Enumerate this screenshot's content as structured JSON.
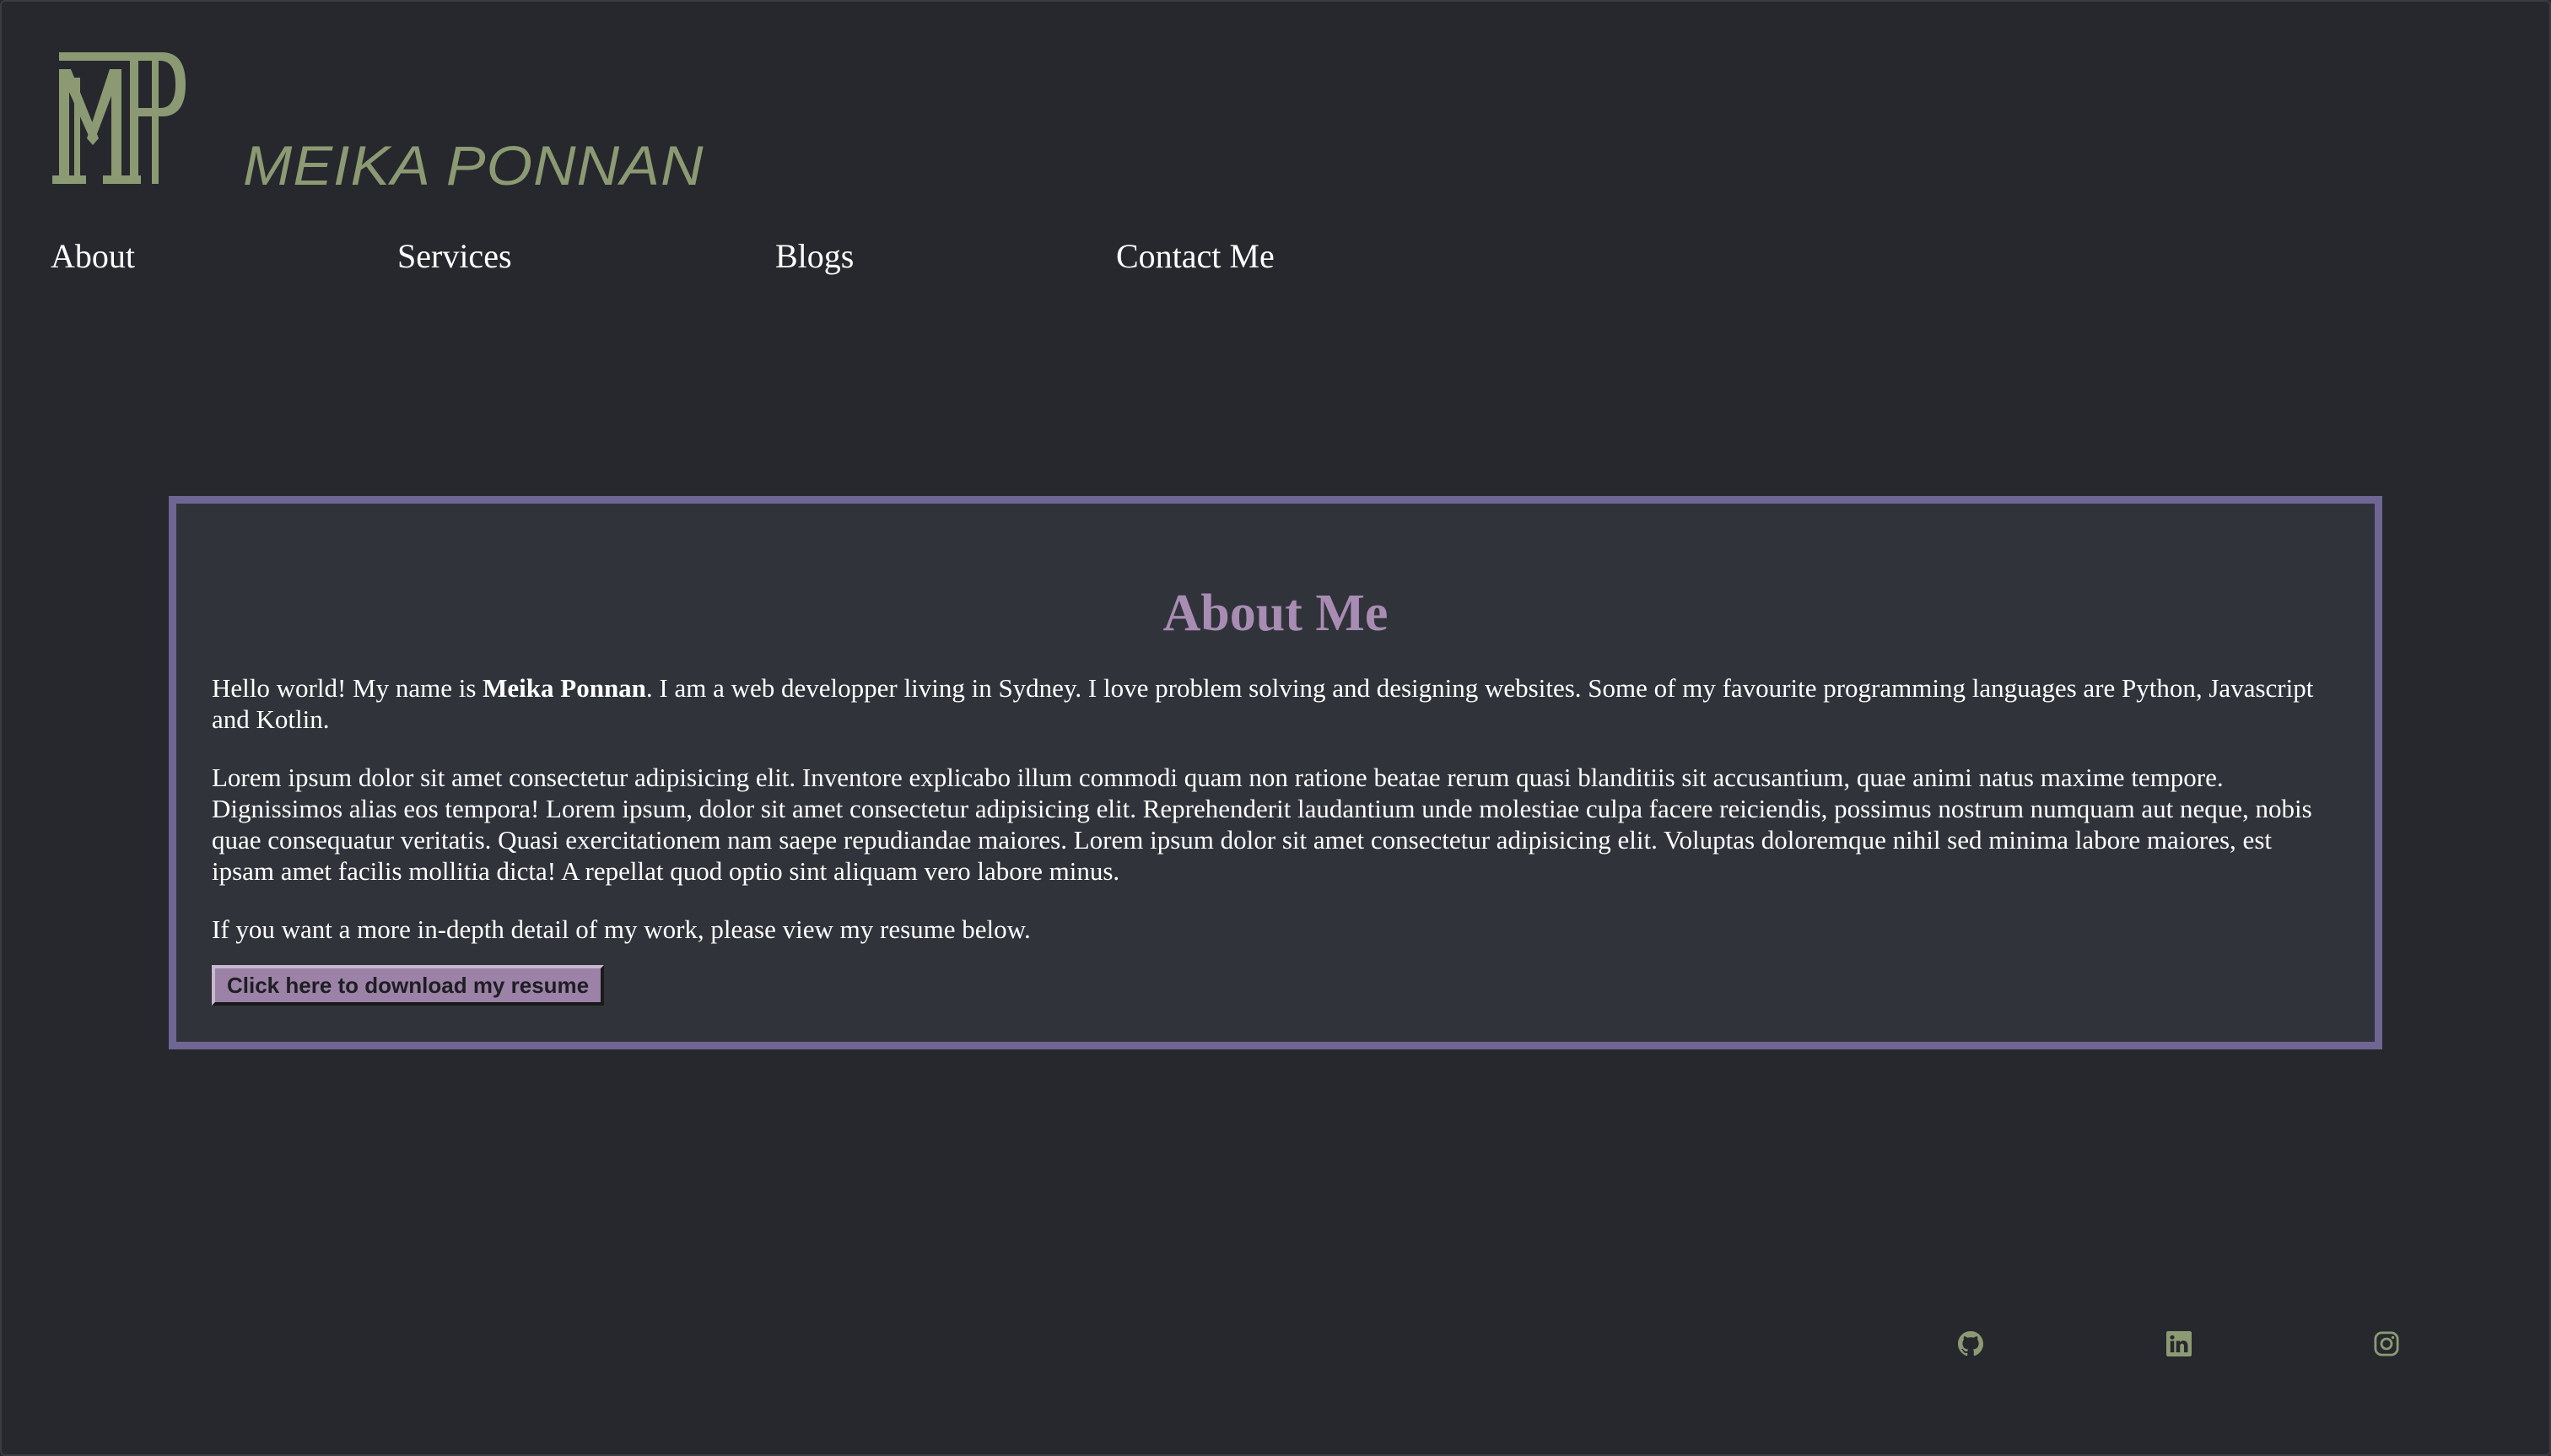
{
  "brand": {
    "name": "MEIKA PONNAN",
    "logo_icon": "mp-monogram-logo",
    "logo_color": "#8c9a73"
  },
  "nav": {
    "items": [
      {
        "label": "About"
      },
      {
        "label": "Services"
      },
      {
        "label": "Blogs"
      },
      {
        "label": "Contact Me"
      }
    ]
  },
  "about": {
    "title": "About Me",
    "intro_before": "Hello world! My name is ",
    "intro_name": "Meika Ponnan",
    "intro_after": ". I am a web developper living in Sydney. I love problem solving and designing websites. Some of my favourite programming languages are Python, Javascript and Kotlin.",
    "lorem": "Lorem ipsum dolor sit amet consectetur adipisicing elit. Inventore explicabo illum commodi quam non ratione beatae rerum quasi blanditiis sit accusantium, quae animi natus maxime tempore. Dignissimos alias eos tempora! Lorem ipsum, dolor sit amet consectetur adipisicing elit. Reprehenderit laudantium unde molestiae culpa facere reiciendis, possimus nostrum numquam aut neque, nobis quae consequatur veritatis. Quasi exercitationem nam saepe repudiandae maiores. Lorem ipsum dolor sit amet consectetur adipisicing elit. Voluptas doloremque nihil sed minima labore maiores, est ipsam amet facilis mollitia dicta! A repellat quod optio sint aliquam vero labore minus.",
    "resume_text": "If you want a more in-depth detail of my work, please view my resume below.",
    "resume_button": "Click here to download my resume"
  },
  "social": {
    "icons": [
      "github-icon",
      "linkedin-icon",
      "instagram-icon"
    ],
    "color": "#8c9a73"
  },
  "colors": {
    "background": "#26282d",
    "card_background": "#30343a",
    "card_border": "#6f6694",
    "accent_title": "#a88cb3",
    "button": "#9b82a6"
  }
}
